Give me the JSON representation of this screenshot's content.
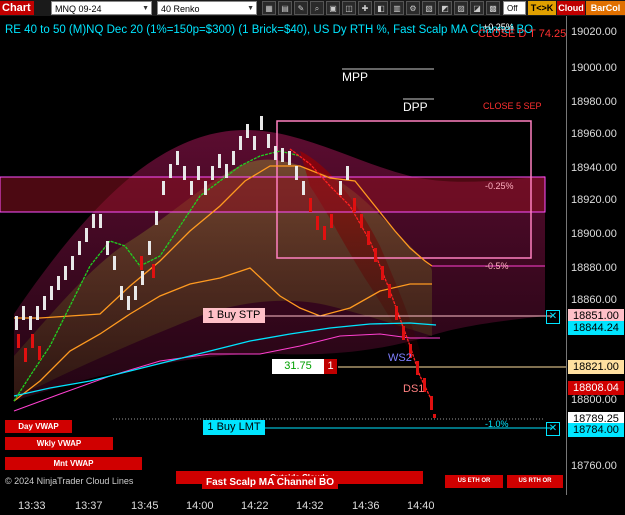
{
  "toolbar": {
    "chart_button": "Chart",
    "instrument": "MNQ 09-24",
    "bar_type": "40 Renko",
    "off_label": "Off",
    "tkk": "T<>K",
    "cloud": "Cloud",
    "barcol": "BarCol"
  },
  "chart": {
    "title": "RE 40 to 50 (M)NQ Dec 20 (1%=150p=$300) (1 Brick=$40), US Dy RTH %, Fast Scalp MA Channel BO",
    "top_pct": "+0.25%",
    "top_right_note": "CLOSE D T 74.25",
    "mpp": "MPP",
    "dpp": "DPP",
    "close_sep": "CLOSE 5 SEP",
    "pct_neg025": "-0.25%",
    "pct_neg05": "-0.5%",
    "pct_neg1": "-1.0%",
    "buy_stp": "1 Buy STP",
    "buy_lmt": "1 Buy LMT",
    "pnl_value": "31.75",
    "pnl_qty": "1",
    "ws2": "WS2",
    "ds1": "DS1",
    "day_vwap": "Day VWAP",
    "wkly_vwap": "Wkly VWAP",
    "mnt_vwap": "Mnt VWAP",
    "copyright": "© 2024 NinjaTrader Cloud Lines",
    "outside_clouds": "Outside Clouds",
    "fast_scalp": "Fast Scalp MA Channel BO",
    "us_eth_or": "US ETH OR",
    "us_rth_or": "US RTH OR"
  },
  "price_axis": {
    "ticks": [
      "19020.00",
      "19000.00",
      "18980.00",
      "18960.00",
      "18940.00",
      "18920.00",
      "18900.00",
      "18880.00",
      "18860.00",
      "18800.00",
      "18760.00"
    ],
    "tags": {
      "buy_stp_price": "18851.00",
      "last_price": "18844.24",
      "position_price": "18821.00",
      "current_price": "18808.04",
      "mid_price": "18789.25",
      "buy_lmt_price": "18784.00"
    }
  },
  "time_axis": [
    "13:33",
    "13:37",
    "13:45",
    "14:00",
    "14:22",
    "14:32",
    "14:36",
    "14:40"
  ],
  "colors": {
    "up_brick": "#e8e8e8",
    "down_brick": "#e01010",
    "buy_stp_tag": "#ffc0c8",
    "buy_lmt_tag": "#00e5ff",
    "position_tag": "#ffe0a0",
    "current_tag": "#d00000"
  }
}
